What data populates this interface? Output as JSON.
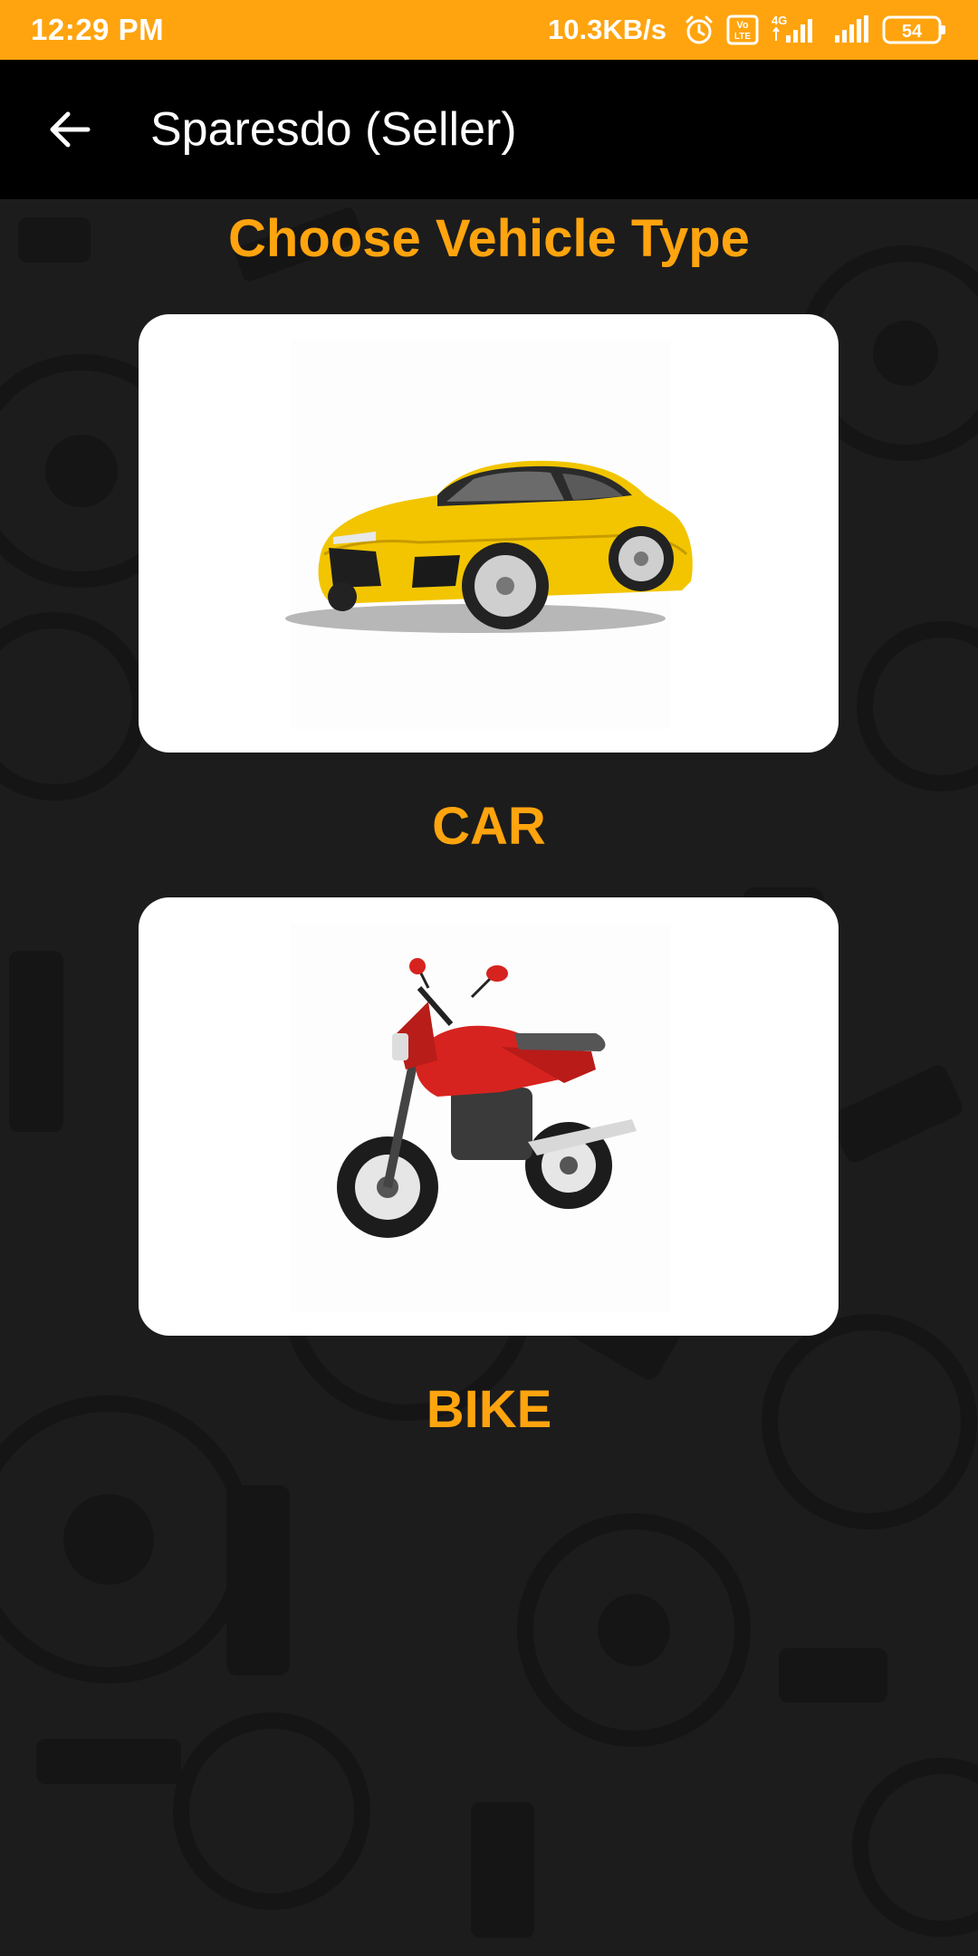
{
  "status_bar": {
    "time": "12:29 PM",
    "network_speed": "10.3KB/s",
    "volte_badge": "Vo LTE",
    "network_type": "4G",
    "battery_level": "54",
    "icons": [
      "alarm-icon",
      "volte-icon",
      "signal-4g-icon",
      "signal-icon",
      "battery-icon"
    ]
  },
  "app_bar": {
    "back_icon": "arrow-left-icon",
    "title": "Sparesdo (Seller)"
  },
  "main": {
    "heading": "Choose Vehicle Type",
    "options": [
      {
        "label": "CAR",
        "image": "yellow-sports-car"
      },
      {
        "label": "BIKE",
        "image": "red-motorcycle"
      }
    ]
  },
  "colors": {
    "accent": "#FFA40E",
    "app_bar": "#000000",
    "background": "#1C1C1C",
    "card": "#FFFFFF"
  }
}
